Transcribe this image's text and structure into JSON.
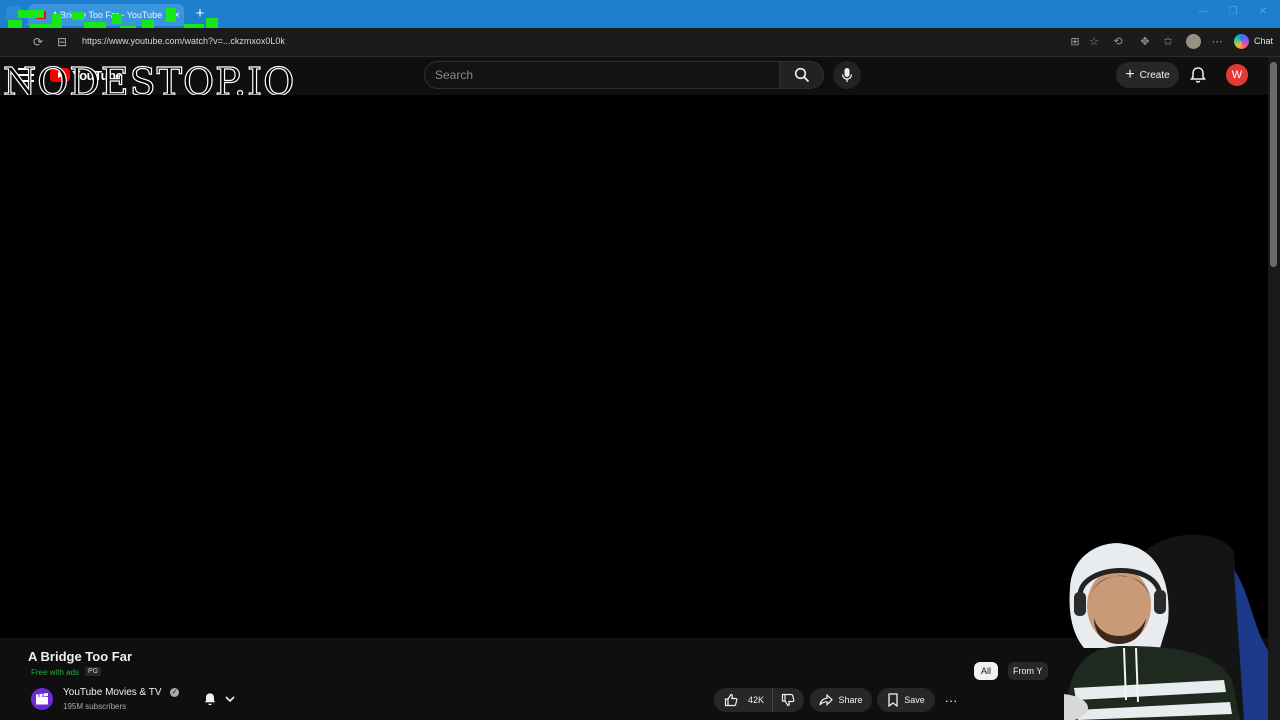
{
  "browser": {
    "tab_title": "A Bridge Too Far - YouTube",
    "tab_close": "×",
    "new_tab": "+",
    "url": "https://www.youtube.com/watch?v=...ckzmxox0L0k",
    "chat_label": "Chat",
    "window_controls": [
      "—",
      "❐",
      "✕"
    ]
  },
  "youtube": {
    "logo_text": "YouTube",
    "search_placeholder": "Search",
    "create_label": "Create",
    "avatar_initial": "W"
  },
  "overlay": {
    "watermark_text": "NODESTOP.IO"
  },
  "video": {
    "title": "A Bridge Too Far",
    "free_badge": "Free with ads",
    "rating": "PG",
    "channel_name": "YouTube Movies & TV",
    "subscribers": "195M subscribers",
    "likes": "42K",
    "share_label": "Share",
    "save_label": "Save",
    "more_label": "···"
  },
  "chips": {
    "all": "All",
    "from": "From Y"
  },
  "colors": {
    "brand_red": "#ff0000",
    "chrome_blue": "#1f7fcf",
    "page_bg": "#0f0f0f",
    "free_green": "#2ba640",
    "avatar_red": "#e53935"
  }
}
